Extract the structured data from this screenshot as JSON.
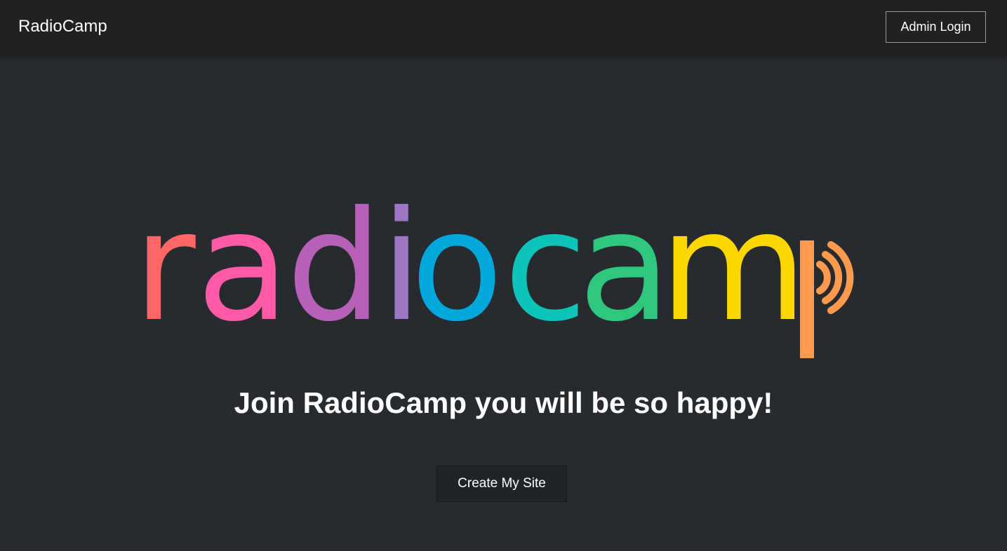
{
  "navbar": {
    "brand": "RadioCamp",
    "admin_login_label": "Admin Login"
  },
  "hero": {
    "logo": {
      "text": "radiocamp",
      "letters": [
        {
          "char": "r",
          "color": "#ff6666"
        },
        {
          "char": "a",
          "color": "#ff5aa6"
        },
        {
          "char": "d",
          "color": "#b860b8"
        },
        {
          "char": "i",
          "color": "#9c78c4"
        },
        {
          "char": "o",
          "color": "#00a8dc"
        },
        {
          "char": "c",
          "color": "#0cc4b8"
        },
        {
          "char": "a",
          "color": "#2ec77e"
        },
        {
          "char": "m",
          "color": "#ffd700"
        },
        {
          "char": "p",
          "color": "#ff9a4d"
        }
      ],
      "icon": "radio-waves-icon"
    },
    "tagline": "Join RadioCamp you will be so happy!",
    "create_site_label": "Create My Site"
  },
  "colors": {
    "background": "#272b2f",
    "navbar": "#212121",
    "text": "#ffffff"
  }
}
